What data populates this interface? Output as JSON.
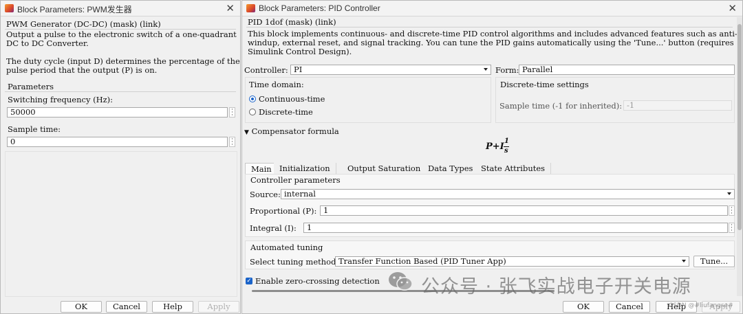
{
  "pwm_dialog": {
    "title": "Block Parameters: PWM发生器",
    "block_heading": "PWM Generator (DC-DC) (mask) (link)",
    "description_1": "Output a pulse to the electronic switch of a one-quadrant\nDC to DC Converter.",
    "description_2": "The duty cycle (input D) determines the percentage of the\npulse period that the output (P) is on.",
    "parameters_label": "Parameters",
    "switching_frequency_label": "Switching frequency (Hz):",
    "switching_frequency_value": "50000",
    "sample_time_label": "Sample time:",
    "sample_time_value": "0",
    "buttons": {
      "ok": "OK",
      "cancel": "Cancel",
      "help": "Help",
      "apply": "Apply"
    }
  },
  "pid_dialog": {
    "title": "Block Parameters: PID Controller",
    "block_heading": "PID 1dof (mask) (link)",
    "description": "This block implements continuous- and discrete-time PID control algorithms and includes advanced features such as anti-\nwindup, external reset, and signal tracking. You can tune the PID gains automatically using the 'Tune...' button (requires\nSimulink Control Design).",
    "controller_label": "Controller:",
    "controller_value": "PI",
    "form_label": "Form:",
    "form_value": "Parallel",
    "time_domain_label": "Time domain:",
    "continuous_label": "Continuous-time",
    "discrete_label": "Discrete-time",
    "discrete_settings_label": "Discrete-time settings",
    "sample_time_label": "Sample time (-1 for inherited):",
    "sample_time_value": "-1",
    "compensator_label": "Compensator formula",
    "formula_lhs": "P+I",
    "formula_num": "1",
    "formula_den": "s",
    "tabs": [
      "Main",
      "Initialization",
      "Output Saturation",
      "Data Types",
      "State Attributes"
    ],
    "active_tab": "Main",
    "controller_params_label": "Controller parameters",
    "source_label": "Source:",
    "source_value": "internal",
    "proportional_label": "Proportional (P):",
    "proportional_value": "1",
    "integral_label": "Integral (I):",
    "integral_value": "1",
    "automated_tuning_label": "Automated tuning",
    "tuning_method_label": "Select tuning method:",
    "tuning_method_value": "Transfer Function Based (PID Tuner App)",
    "tune_button": "Tune...",
    "zero_crossing_label": "Enable zero-crossing detection",
    "buttons": {
      "ok": "OK",
      "cancel": "Cancel",
      "help": "Help",
      "apply": "Apply"
    }
  },
  "watermark": {
    "text": "公众号 · 张飞实战电子开关电源",
    "credit": "CSDN @#liufangse#"
  },
  "colors": {
    "accent": "#1a63c9",
    "window_bg": "#f0f0f0",
    "field_border": "#a8a8a8"
  }
}
